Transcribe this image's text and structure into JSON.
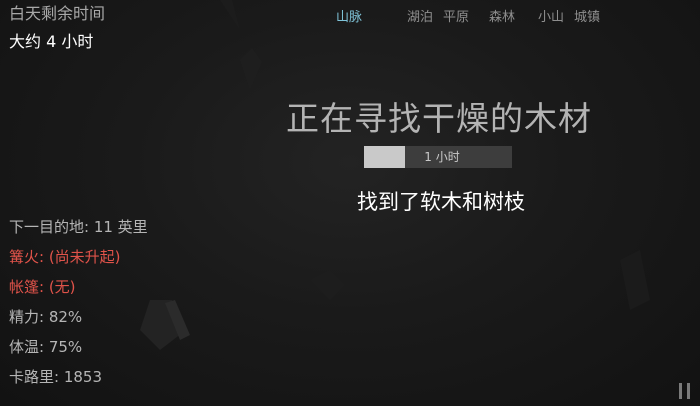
{
  "daylight": {
    "label": "白天剩余时间",
    "value": "大约 4 小时"
  },
  "terrain_tabs": [
    {
      "label": "山脉",
      "active": true
    },
    {
      "label": "湖泊",
      "active": false
    },
    {
      "label": "平原",
      "active": false
    },
    {
      "label": "森林",
      "active": false
    },
    {
      "label": "小山",
      "active": false
    },
    {
      "label": "城镇",
      "active": false
    }
  ],
  "action": {
    "title": "正在寻找干燥的木材",
    "progress_label": "1 小时",
    "progress_fraction": 0.28,
    "result": "找到了软木和树枝"
  },
  "stats": {
    "destination": "下一目的地: 11 英里",
    "campfire": "篝火: (尚未升起)",
    "tent": "帐篷: (无)",
    "energy": "精力: 82%",
    "body_temp": "体温: 75%",
    "calories": "卡路里: 1853"
  },
  "colors": {
    "active_tab": "#7fc3d8",
    "warning": "#e0534a"
  },
  "icons": {
    "pause": "pause-icon"
  }
}
